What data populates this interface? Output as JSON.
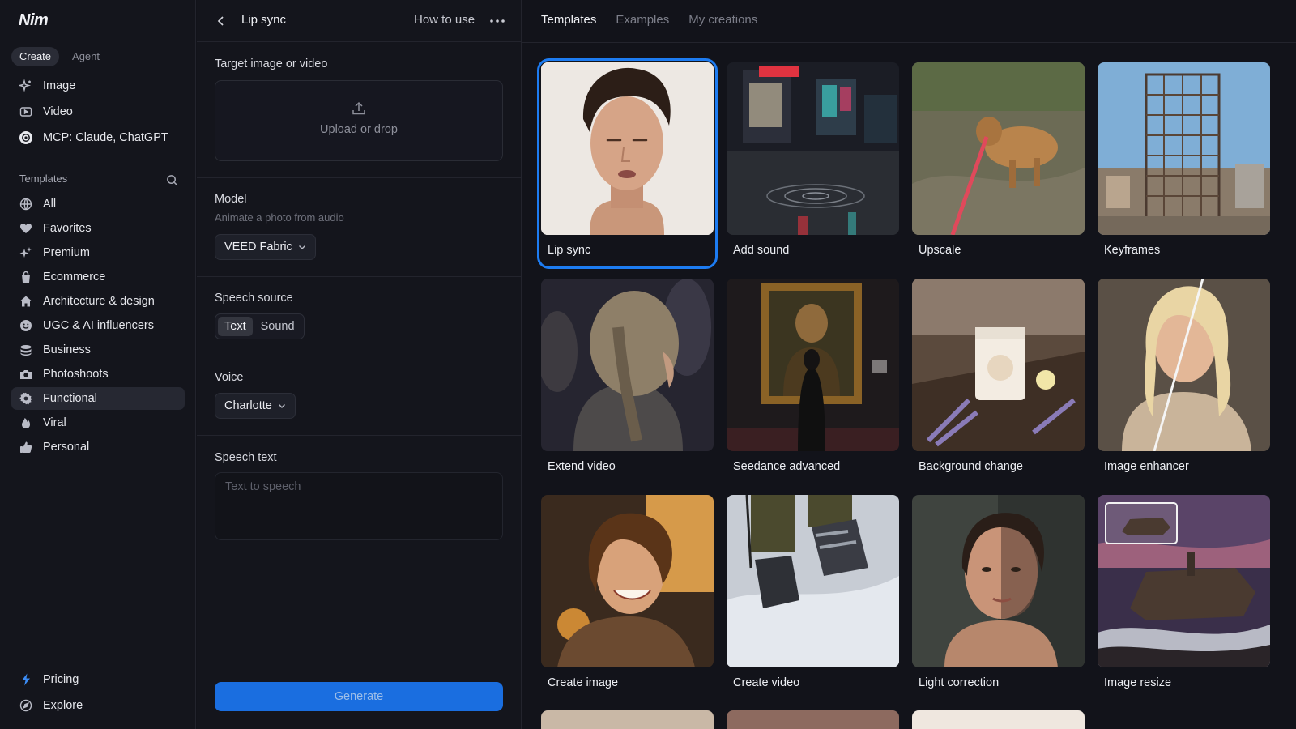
{
  "app": {
    "logo": "Nim"
  },
  "sidebar": {
    "mode_tabs": [
      {
        "label": "Create",
        "active": true
      },
      {
        "label": "Agent",
        "active": false
      }
    ],
    "top_items": [
      {
        "label": "Image",
        "icon": "sparkle-icon"
      },
      {
        "label": "Video",
        "icon": "video-icon"
      },
      {
        "label": "MCP: Claude, ChatGPT",
        "icon": "openai-icon"
      }
    ],
    "templates_label": "Templates",
    "template_items": [
      {
        "label": "All",
        "icon": "globe-icon"
      },
      {
        "label": "Favorites",
        "icon": "heart-icon"
      },
      {
        "label": "Premium",
        "icon": "sparkles-icon"
      },
      {
        "label": "Ecommerce",
        "icon": "bag-icon"
      },
      {
        "label": "Architecture & design",
        "icon": "home-icon"
      },
      {
        "label": "UGC & AI influencers",
        "icon": "smiley-icon"
      },
      {
        "label": "Business",
        "icon": "stack-icon"
      },
      {
        "label": "Photoshoots",
        "icon": "camera-icon"
      },
      {
        "label": "Functional",
        "icon": "gear-icon",
        "active": true
      },
      {
        "label": "Viral",
        "icon": "flame-icon"
      },
      {
        "label": "Personal",
        "icon": "thumbs-up-icon"
      }
    ],
    "bottom_items": [
      {
        "label": "Pricing",
        "icon": "bolt-icon"
      },
      {
        "label": "Explore",
        "icon": "compass-icon"
      }
    ]
  },
  "panel": {
    "title": "Lip sync",
    "how_to_use": "How to use",
    "target_label": "Target image or video",
    "upload_text": "Upload or drop",
    "model_label": "Model",
    "model_sub": "Animate a photo from audio",
    "model_value": "VEED Fabric",
    "speech_source_label": "Speech source",
    "speech_source_options": [
      {
        "label": "Text",
        "active": true
      },
      {
        "label": "Sound",
        "active": false
      }
    ],
    "voice_label": "Voice",
    "voice_value": "Charlotte",
    "speech_text_label": "Speech text",
    "speech_text_placeholder": "Text to speech",
    "generate_label": "Generate",
    "colors": {
      "accent": "#1a6ee0"
    }
  },
  "gallery": {
    "tabs": [
      {
        "label": "Templates",
        "active": true
      },
      {
        "label": "Examples",
        "active": false
      },
      {
        "label": "My creations",
        "active": false
      }
    ],
    "cards": [
      {
        "label": "Lip sync",
        "selected": true
      },
      {
        "label": "Add sound"
      },
      {
        "label": "Upscale"
      },
      {
        "label": "Keyframes"
      },
      {
        "label": "Extend video"
      },
      {
        "label": "Seedance advanced"
      },
      {
        "label": "Background change"
      },
      {
        "label": "Image enhancer"
      },
      {
        "label": "Create image"
      },
      {
        "label": "Create video"
      },
      {
        "label": "Light correction"
      },
      {
        "label": "Image resize"
      }
    ]
  }
}
